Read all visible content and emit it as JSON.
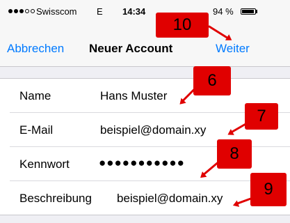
{
  "status_bar": {
    "carrier": "Swisscom",
    "network": "E",
    "time": "14:34",
    "battery_percent": "94 %",
    "battery_level": 0.94,
    "signal_bars": 3,
    "signal_bars_total": 5
  },
  "nav": {
    "cancel_label": "Abbrechen",
    "title": "Neuer Account",
    "next_label": "Weiter"
  },
  "form": {
    "rows": [
      {
        "label": "Name",
        "value": "Hans Muster"
      },
      {
        "label": "E-Mail",
        "value": "beispiel@domain.xy"
      },
      {
        "label": "Kennwort",
        "value": "●●●●●●●●●●●"
      },
      {
        "label": "Beschreibung",
        "value": "beispiel@domain.xy"
      }
    ]
  },
  "markers": [
    "10",
    "6",
    "7",
    "8",
    "9"
  ],
  "colors": {
    "accent": "#007aff",
    "marker": "#e00000"
  }
}
